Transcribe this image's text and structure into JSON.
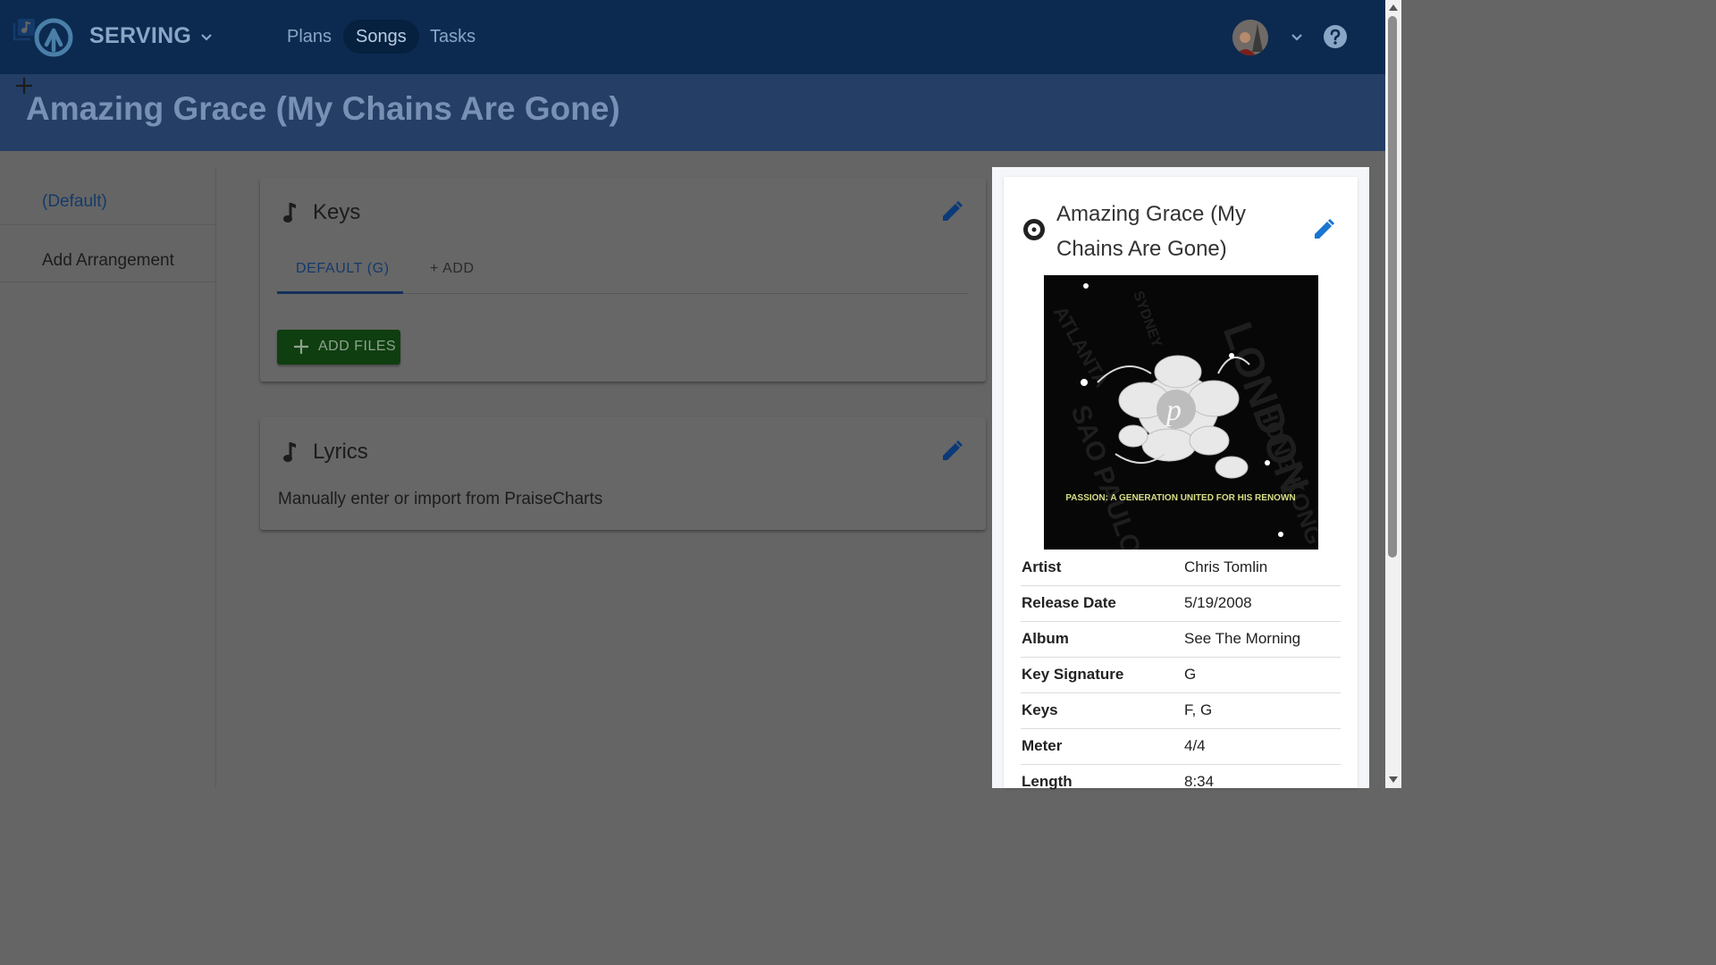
{
  "app": {
    "name": "SERVING"
  },
  "nav": {
    "items": [
      {
        "label": "Plans",
        "active": false
      },
      {
        "label": "Songs",
        "active": true
      },
      {
        "label": "Tasks",
        "active": false
      }
    ]
  },
  "header": {
    "title": "Amazing Grace (My Chains Are Gone)"
  },
  "sidebar": {
    "items": [
      {
        "label": "(Default)",
        "icon": "music-library-icon"
      },
      {
        "label": "Add Arrangement",
        "icon": "plus-icon"
      }
    ]
  },
  "keys_card": {
    "title": "Keys",
    "tabs": [
      {
        "label": "DEFAULT (G)",
        "active": true
      },
      {
        "label": "+ ADD",
        "active": false
      }
    ],
    "add_files_label": "ADD FILES"
  },
  "lyrics_card": {
    "title": "Lyrics",
    "text": "Manually enter or import from PraiseCharts"
  },
  "song_details": {
    "title": "Amazing Grace (My Chains Are Gone)",
    "album_art_caption": "PASSION: A GENERATION UNITED FOR HIS RENOWN",
    "rows": [
      {
        "label": "Artist",
        "value": "Chris Tomlin"
      },
      {
        "label": "Release Date",
        "value": "5/19/2008"
      },
      {
        "label": "Album",
        "value": "See The Morning"
      },
      {
        "label": "Key Signature",
        "value": "G"
      },
      {
        "label": "Keys",
        "value": "F, G"
      },
      {
        "label": "Meter",
        "value": "4/4"
      },
      {
        "label": "Length",
        "value": "8:34"
      }
    ]
  },
  "colors": {
    "nav_bg": "#0c2a50",
    "title_band_bg": "#243e66",
    "accent_blue": "#1565c0",
    "add_files_green": "#0f3e10",
    "overlay_gray": "#656565"
  }
}
